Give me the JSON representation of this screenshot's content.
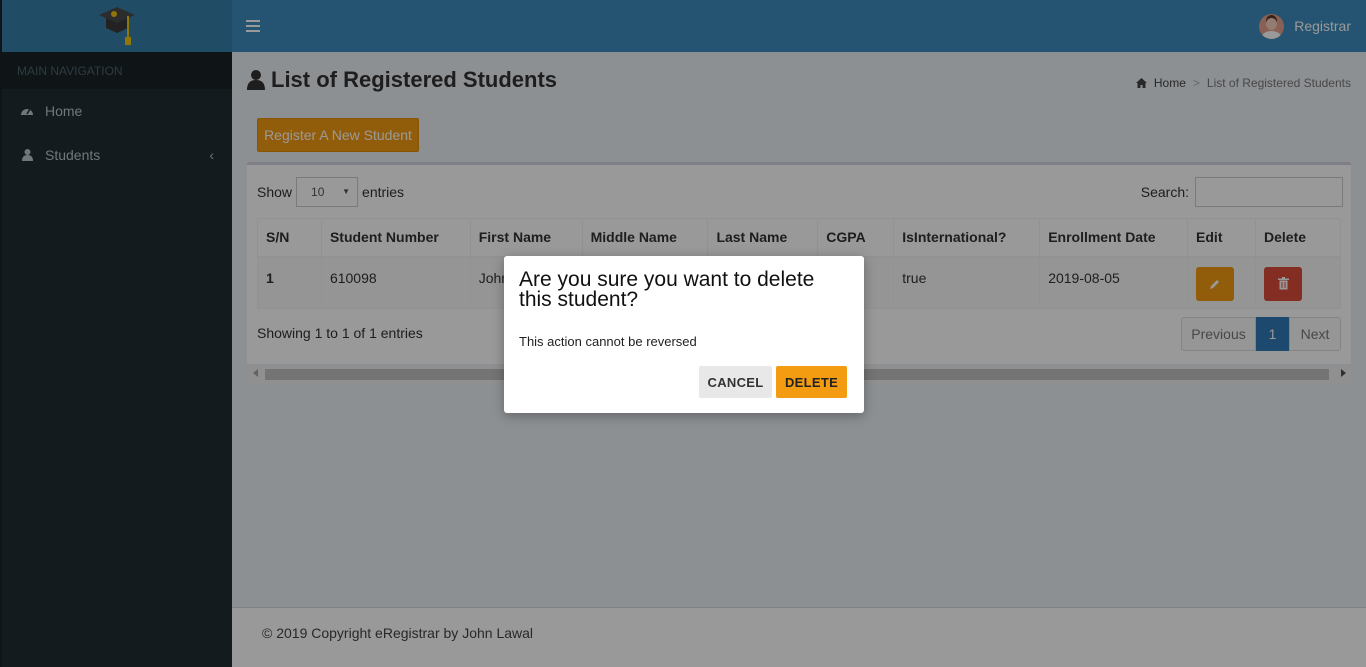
{
  "sidebar": {
    "logo_icon": "graduation-cap-icon",
    "nav_header": "MAIN NAVIGATION",
    "items": [
      {
        "label": "Home",
        "icon": "dashboard-icon"
      },
      {
        "label": "Students",
        "icon": "user-icon",
        "has_submenu": true
      }
    ]
  },
  "header": {
    "user_name": "Registrar",
    "accent": "#3c8dbc"
  },
  "page": {
    "title": "List of Registered Students",
    "breadcrumb": {
      "home": "Home",
      "current": "List of Registered Students"
    },
    "register_button": "Register A New Student"
  },
  "table": {
    "show_label": "Show",
    "entries_label": "entries",
    "page_size": "10",
    "search_label": "Search:",
    "search_value": "",
    "columns": [
      "S/N",
      "Student Number",
      "First Name",
      "Middle Name",
      "Last Name",
      "CGPA",
      "IsInternational?",
      "Enrollment Date",
      "Edit",
      "Delete"
    ],
    "rows": [
      {
        "sn": "1",
        "student_number": "610098",
        "first_name": "John",
        "middle_name": "",
        "last_name": "",
        "cgpa": "",
        "is_international": "true",
        "enrollment_date": "2019-08-05"
      }
    ],
    "info": "Showing 1 to 1 of 1 entries",
    "pagination": {
      "previous": "Previous",
      "current": "1",
      "next": "Next"
    }
  },
  "footer": {
    "text": "© 2019 Copyright eRegistrar by John Lawal"
  },
  "dialog": {
    "title": "Are you sure you want to delete this student?",
    "message": "This action cannot be reversed",
    "cancel_label": "CANCEL",
    "delete_label": "DELETE",
    "delete_color": "#f39c12"
  }
}
